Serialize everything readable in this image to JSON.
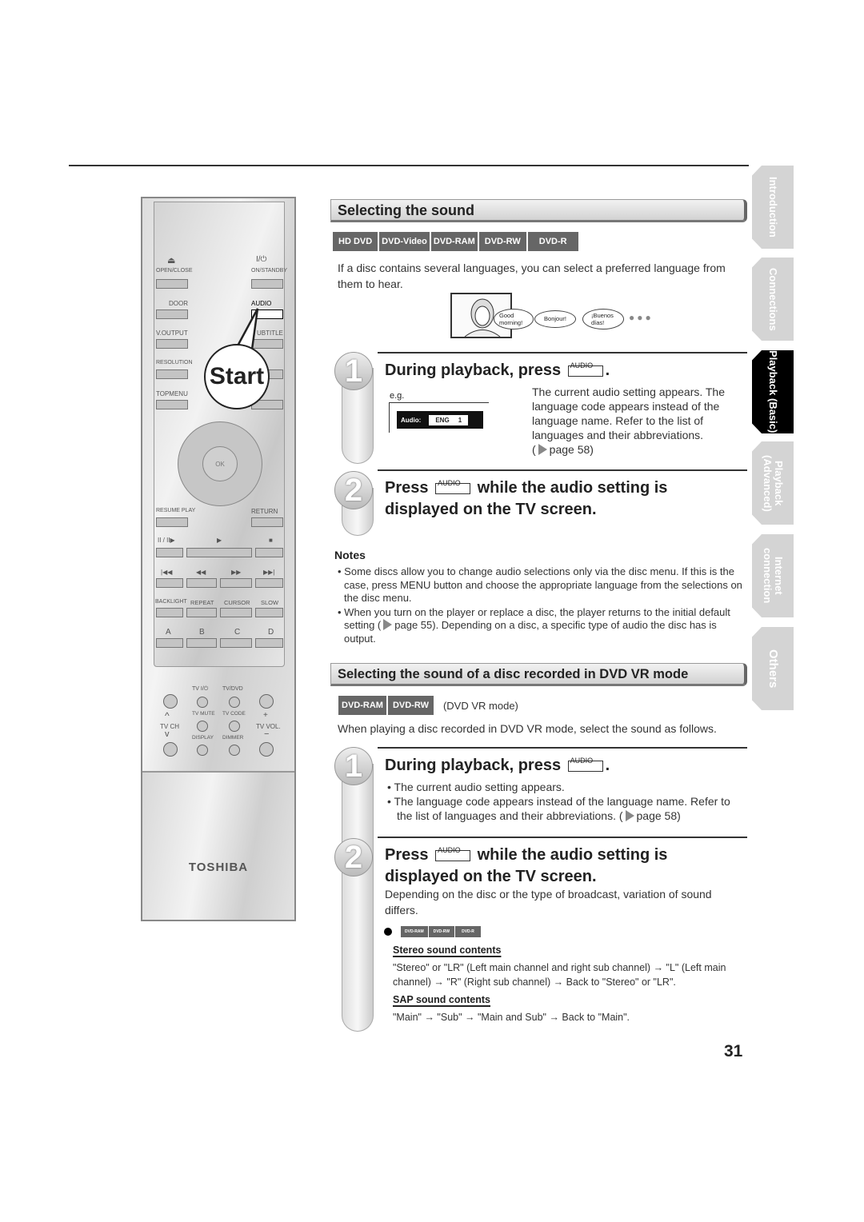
{
  "remote": {
    "labels": {
      "open_close": "OPEN/CLOSE",
      "on_standby": "ON/STANDBY",
      "door": "DOOR",
      "audio": "AUDIO",
      "v_output": "V.OUTPUT",
      "subtitle": "UBTITLE",
      "resolution": "RESOLUTION",
      "topmenu": "TOPMENU",
      "ok": "OK",
      "resume_play": "RESUME PLAY",
      "return": "RETURN",
      "pause_step": "II / II▶",
      "play": "▶",
      "stop": "■",
      "skip_back": "|◀◀",
      "rewind": "◀◀",
      "ffwd": "▶▶",
      "skip_fwd": "▶▶|",
      "backlight": "BACKLIGHT",
      "repeat": "REPEAT",
      "cursor": "CURSOR",
      "slow": "SLOW",
      "a": "A",
      "b": "B",
      "c": "C",
      "d": "D",
      "tv_power": "TV  I/⏻",
      "tv_dvd": "TV/DVD",
      "tv_mute": "TV MUTE",
      "tv_code": "TV CODE",
      "tv_ch": "TV CH",
      "tv_vol": "TV VOL.",
      "plus": "+",
      "minus": "−",
      "display": "DISPLAY",
      "dimmer": "DIMMER",
      "eject": "⏏",
      "power": "I/⏻"
    },
    "brand": "TOSHIBA",
    "callout": "Start"
  },
  "section1": {
    "title": "Selecting the sound",
    "badges": [
      "HD DVD",
      "DVD-Video",
      "DVD-RAM",
      "DVD-RW",
      "DVD-R"
    ],
    "intro": "If a disc contains several languages, you can select a preferred language from them to hear.",
    "bubbles": [
      "Good morning!",
      "Bonjour!",
      "¡Buenos días!"
    ],
    "step1": {
      "num": "1",
      "title_a": "During playback, press",
      "key": "AUDIO",
      "title_b": ".",
      "eg": "e.g.",
      "osd_label": "Audio:",
      "osd_value": "ENG     1",
      "desc": "The current audio setting appears. The language code appears instead of the language name. Refer to the list of languages and their abbreviations.",
      "ref": "page 58"
    },
    "step2": {
      "num": "2",
      "title_a": "Press",
      "key": "AUDIO",
      "title_b": "while the audio setting is displayed on the TV screen."
    },
    "notes_title": "Notes",
    "notes": [
      "Some discs allow you to change audio selections only via the disc menu. If this is the case, press MENU button and choose the appropriate language from the selections on the disc menu.",
      "When you turn on the player or replace a disc, the player returns to the initial default setting (",
      "page 55). Depending on a disc, a specific type of audio the disc has is output."
    ]
  },
  "section2": {
    "title": "Selecting the sound of a disc recorded in DVD VR mode",
    "badges": [
      "DVD-RAM",
      "DVD-RW"
    ],
    "mode": "(DVD VR mode)",
    "intro": "When playing a disc recorded in DVD VR mode, select the sound as follows.",
    "step1": {
      "num": "1",
      "title_a": "During playback, press",
      "key": "AUDIO",
      "title_b": ".",
      "bullets": [
        "The current audio setting appears.",
        "The language code appears instead of the language name. Refer to the list of languages and their abbreviations. ("
      ],
      "ref": "page 58)"
    },
    "step2": {
      "num": "2",
      "title_a": "Press",
      "key": "AUDIO",
      "title_b": "while the audio setting is displayed on the TV screen.",
      "desc": "Depending on the disc or the type of broadcast, variation of sound differs.",
      "badges": [
        "DVD-RAM",
        "DVD-RW",
        "DVD-R"
      ],
      "stereo_title": "Stereo sound contents",
      "stereo_text": "\"Stereo\" or \"LR\" (Left main channel and right sub channel) → \"L\" (Left main channel) → \"R\" (Right sub channel) → Back to \"Stereo\" or \"LR\".",
      "sap_title": "SAP sound contents",
      "sap_text": "\"Main\" → \"Sub\" → \"Main and Sub\" → Back to \"Main\"."
    }
  },
  "tabs": [
    {
      "label": "Introduction"
    },
    {
      "label": "Connections"
    },
    {
      "label": "Playback (Basic)",
      "active": true
    },
    {
      "label": "Playback (Advanced)"
    },
    {
      "label": "Internet connection"
    },
    {
      "label": "Others"
    }
  ],
  "page_number": "31"
}
